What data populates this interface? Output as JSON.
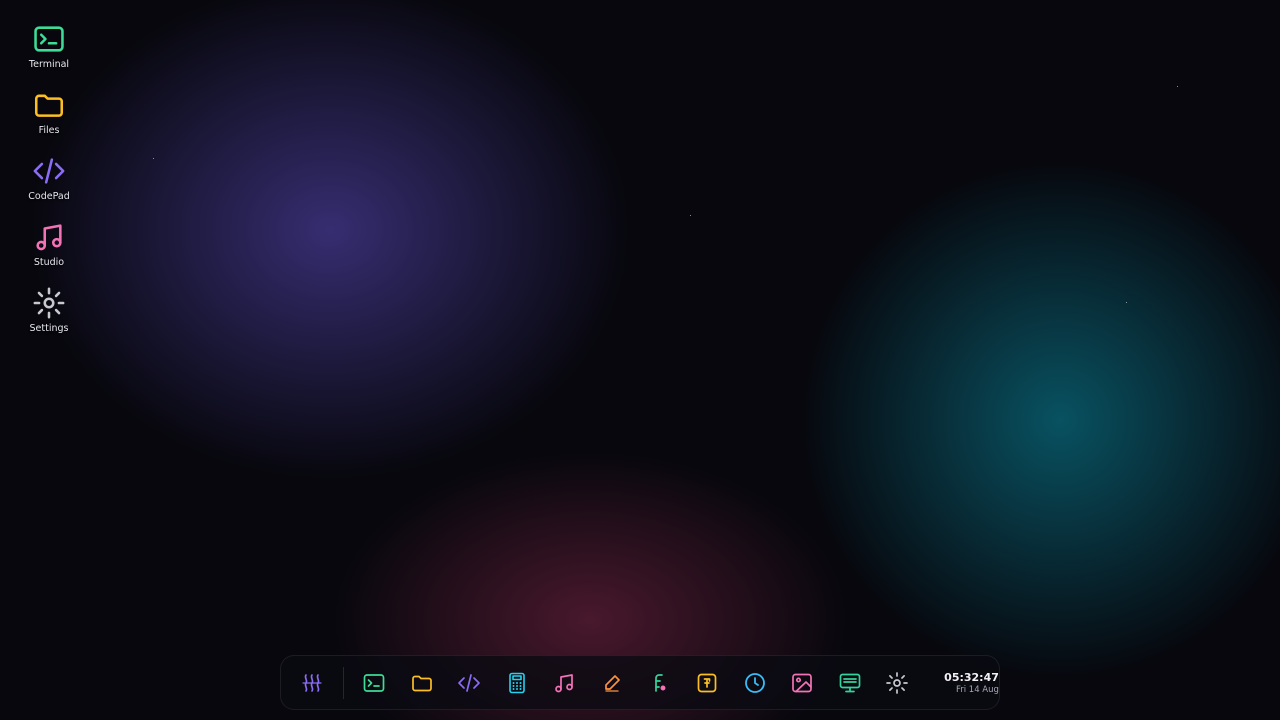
{
  "desktop": {
    "icons": [
      {
        "label": "Terminal",
        "icon": "terminal-icon",
        "color": "#3ddc97"
      },
      {
        "label": "Files",
        "icon": "folder-icon",
        "color": "#fbbf24"
      },
      {
        "label": "CodePad",
        "icon": "code-icon",
        "color": "#8b6cf5"
      },
      {
        "label": "Studio",
        "icon": "music-note-icon",
        "color": "#f472b6"
      },
      {
        "label": "Settings",
        "icon": "gear-icon",
        "color": "#c8c8d0"
      }
    ]
  },
  "dock": {
    "launcher": {
      "icon": "launcher-waves-icon",
      "color": "#8b6cf5"
    },
    "apps": [
      {
        "icon": "terminal-icon",
        "color": "#3ddc97"
      },
      {
        "icon": "folder-icon",
        "color": "#fbbf24"
      },
      {
        "icon": "code-icon",
        "color": "#8b6cf5"
      },
      {
        "icon": "calculator-icon",
        "color": "#22d3ee"
      },
      {
        "icon": "music-note-icon",
        "color": "#f472b6"
      },
      {
        "icon": "brush-icon",
        "color": "#fb923c"
      },
      {
        "icon": "paint-icon",
        "color": "#34d399"
      },
      {
        "icon": "font-icon",
        "color": "#fbbf24"
      },
      {
        "icon": "clock-icon",
        "color": "#38bdf8"
      },
      {
        "icon": "image-icon",
        "color": "#f472b6"
      },
      {
        "icon": "monitor-icon",
        "color": "#34d399"
      },
      {
        "icon": "gear-icon",
        "color": "#c8c8d0"
      }
    ],
    "clock": {
      "time": "05:32:47",
      "date": "Fri 14 Aug"
    }
  }
}
